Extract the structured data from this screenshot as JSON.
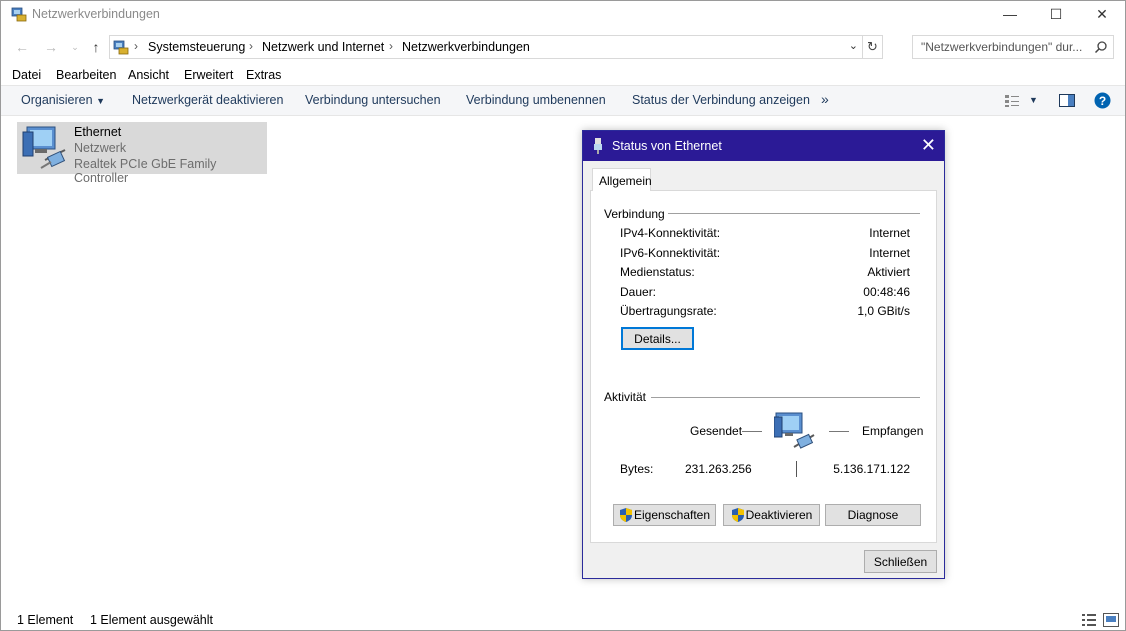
{
  "window": {
    "title": "Netzwerkverbindungen",
    "controls": {
      "minimize": "—",
      "maximize": "☐",
      "close": "✕"
    }
  },
  "address": {
    "breadcrumbs": [
      "Systemsteuerung",
      "Netzwerk und Internet",
      "Netzwerkverbindungen"
    ],
    "search_placeholder": "\"Netzwerkverbindungen\" dur..."
  },
  "menu": [
    "Datei",
    "Bearbeiten",
    "Ansicht",
    "Erweitert",
    "Extras"
  ],
  "commands": {
    "organize": "Organisieren",
    "items": [
      "Netzwerkgerät deaktivieren",
      "Verbindung untersuchen",
      "Verbindung umbenennen",
      "Status der Verbindung anzeigen"
    ],
    "more": "»"
  },
  "connection": {
    "name": "Ethernet",
    "network": "Netzwerk",
    "adapter": "Realtek PCIe GbE Family Controller"
  },
  "statusbar": {
    "count": "1 Element",
    "selected": "1 Element ausgewählt"
  },
  "dialog": {
    "title": "Status von Ethernet",
    "tab": "Allgemein",
    "connection_group": "Verbindung",
    "rows": [
      {
        "label": "IPv4-Konnektivität:",
        "value": "Internet"
      },
      {
        "label": "IPv6-Konnektivität:",
        "value": "Internet"
      },
      {
        "label": "Medienstatus:",
        "value": "Aktiviert"
      },
      {
        "label": "Dauer:",
        "value": "00:48:46"
      },
      {
        "label": "Übertragungsrate:",
        "value": "1,0 GBit/s"
      }
    ],
    "details_button": "Details...",
    "activity_group": "Aktivität",
    "sent_label": "Gesendet",
    "received_label": "Empfangen",
    "bytes_label": "Bytes:",
    "bytes_sent": "231.263.256",
    "bytes_received": "5.136.171.122",
    "properties_button": "Eigenschaften",
    "disable_button": "Deaktivieren",
    "diagnose_button": "Diagnose",
    "close_button": "Schließen"
  },
  "colors": {
    "dialog_titlebar": "#2b1a96",
    "selection": "#d9d9d9",
    "command_text": "#1e395b",
    "help": "#0063b1"
  }
}
